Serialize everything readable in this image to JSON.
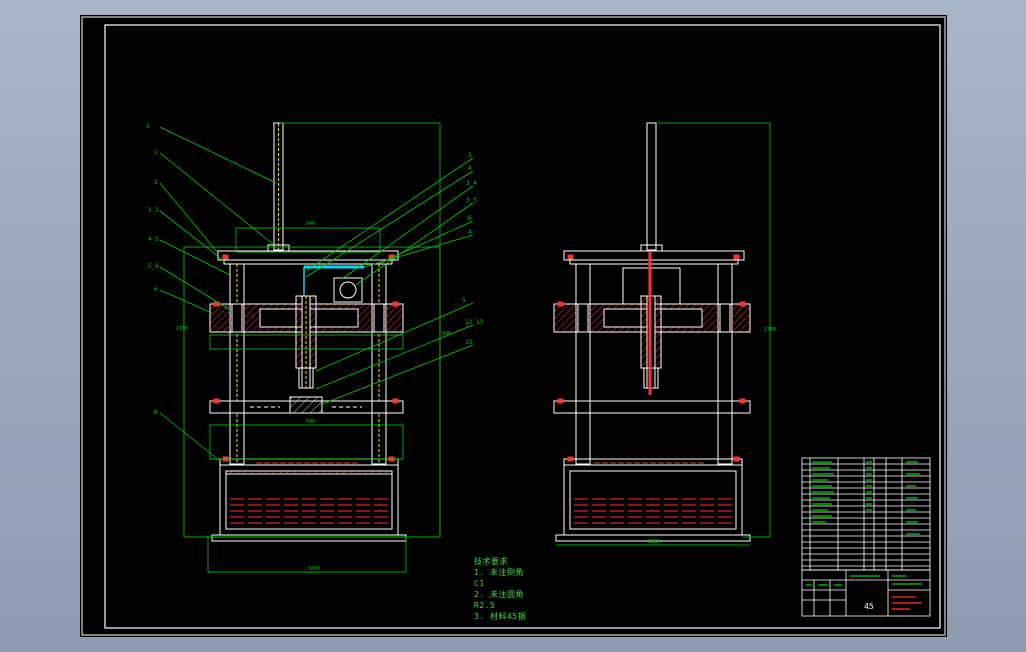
{
  "drawing": {
    "leader_labels_left": [
      "3",
      "1",
      "2",
      "2_3",
      "4_5",
      "5_6",
      "6"
    ],
    "leader_labels_right": [
      "3",
      "4",
      "3_4",
      "3_5",
      "6",
      "4",
      "5"
    ],
    "lower_labels_right": [
      "12_13",
      "13",
      "11"
    ],
    "bottom_label_left": "6",
    "notes": [
      "技术要求",
      "1. 未注倒角",
      "C1",
      "2. 未注圆角",
      "R2.5",
      "3. 材料45钢"
    ],
    "title_block": {
      "material": "45"
    }
  },
  "colors": {
    "outline": "#ffffff",
    "dimension": "#00d000",
    "hatch": "#ff3030",
    "cyan": "#00d8ff",
    "yellow": "#ffe000"
  }
}
